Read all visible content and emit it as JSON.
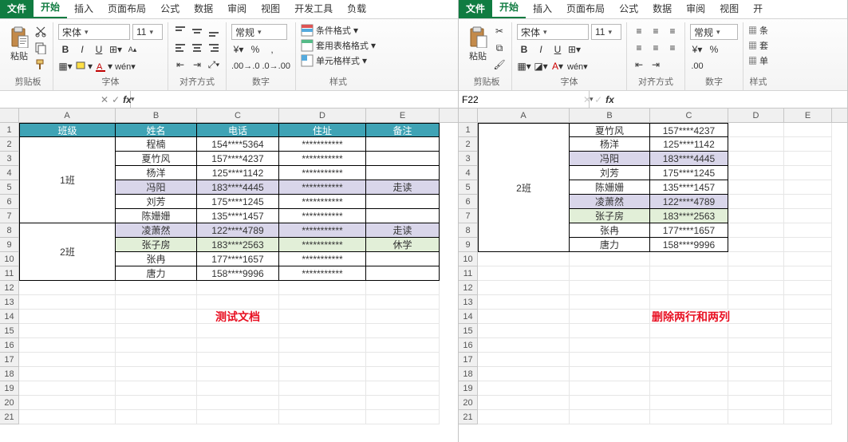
{
  "tabs": [
    "文件",
    "开始",
    "插入",
    "页面布局",
    "公式",
    "数据",
    "审阅",
    "视图",
    "开发工具",
    "负载"
  ],
  "tabs_right": [
    "文件",
    "开始",
    "插入",
    "页面布局",
    "公式",
    "数据",
    "审阅",
    "视图",
    "开"
  ],
  "active_tab_index": 1,
  "ribbon": {
    "clipboard": {
      "label": "剪贴板",
      "paste": "粘贴"
    },
    "font": {
      "label": "字体",
      "name": "宋体",
      "size": "11",
      "bold": "B",
      "italic": "I",
      "underline": "U"
    },
    "align": {
      "label": "对齐方式"
    },
    "number": {
      "label": "数字",
      "format": "常规"
    },
    "styles": {
      "label": "样式",
      "cond": "条件格式",
      "table": "套用表格格式",
      "cell": "单元格样式"
    }
  },
  "fx": {
    "name_left": "",
    "name_right": "F22"
  },
  "left_cols": {
    "labels": [
      "A",
      "B",
      "C",
      "D",
      "E"
    ],
    "widths": [
      121,
      102,
      103,
      109,
      92
    ]
  },
  "right_cols": {
    "labels": [
      "A",
      "B",
      "C",
      "D",
      "E"
    ],
    "widths": [
      115,
      101,
      98,
      70,
      60
    ]
  },
  "left_table": {
    "header": [
      "班级",
      "姓名",
      "电话",
      "住址",
      "备注"
    ],
    "class1": "1班",
    "class2": "2班",
    "rows": [
      {
        "b": "程楠",
        "c": "154****5364",
        "d": "***********",
        "e": ""
      },
      {
        "b": "夏竹风",
        "c": "157****4237",
        "d": "***********",
        "e": ""
      },
      {
        "b": "杨洋",
        "c": "125****1142",
        "d": "***********",
        "e": ""
      },
      {
        "b": "冯阳",
        "c": "183****4445",
        "d": "***********",
        "e": "走读",
        "hl": "purple"
      },
      {
        "b": "刘芳",
        "c": "175****1245",
        "d": "***********",
        "e": ""
      },
      {
        "b": "陈姗姗",
        "c": "135****1457",
        "d": "***********",
        "e": ""
      },
      {
        "b": "凌萧然",
        "c": "122****4789",
        "d": "***********",
        "e": "走读",
        "hl": "purple"
      },
      {
        "b": "张子房",
        "c": "183****2563",
        "d": "***********",
        "e": "休学",
        "hl": "green"
      },
      {
        "b": "张冉",
        "c": "177****1657",
        "d": "***********",
        "e": ""
      },
      {
        "b": "唐力",
        "c": "158****9996",
        "d": "***********",
        "e": ""
      }
    ],
    "note": "测试文档"
  },
  "right_table": {
    "class2": "2班",
    "rows": [
      {
        "b": "夏竹风",
        "c": "157****4237"
      },
      {
        "b": "杨洋",
        "c": "125****1142"
      },
      {
        "b": "冯阳",
        "c": "183****4445",
        "hl": "purple"
      },
      {
        "b": "刘芳",
        "c": "175****1245"
      },
      {
        "b": "陈姗姗",
        "c": "135****1457"
      },
      {
        "b": "凌萧然",
        "c": "122****4789",
        "hl": "purple"
      },
      {
        "b": "张子房",
        "c": "183****2563",
        "hl": "green"
      },
      {
        "b": "张冉",
        "c": "177****1657"
      },
      {
        "b": "唐力",
        "c": "158****9996"
      }
    ],
    "note": "删除两行和两列"
  },
  "row_count": 21,
  "chart_data": null
}
